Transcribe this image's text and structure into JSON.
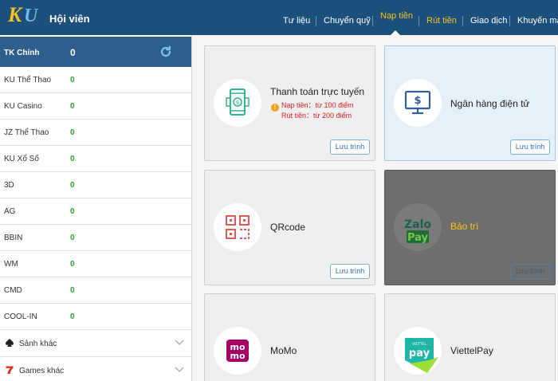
{
  "header": {
    "logo_text": "KU",
    "title": "Hội viên",
    "nav": [
      "Tư liệu",
      "Chuyển quỹ",
      "Nạp tiền",
      "Rút tiền",
      "Giao dịch",
      "Khuyến mãi"
    ],
    "active_nav": "Nạp tiền"
  },
  "sidebar": {
    "main_label": "TK Chính",
    "main_value": "0",
    "wallets": [
      {
        "name": "KU Thể Thao",
        "value": "0"
      },
      {
        "name": "KU Casino",
        "value": "0"
      },
      {
        "name": "JZ Thể Thao",
        "value": "0"
      },
      {
        "name": "KU Xổ Số",
        "value": "0"
      },
      {
        "name": "3D",
        "value": "0"
      },
      {
        "name": "AG",
        "value": "0"
      },
      {
        "name": "BBIN",
        "value": "0"
      },
      {
        "name": "WM",
        "value": "0"
      },
      {
        "name": "CMD",
        "value": "0"
      },
      {
        "name": "COOL-IN",
        "value": "0"
      }
    ],
    "more": [
      {
        "label": "Sảnh khác",
        "icon": "spade-icon"
      },
      {
        "label": "Games khác",
        "icon": "seven-icon"
      }
    ]
  },
  "cards": {
    "online": {
      "title": "Thanh toán trực tuyến",
      "note1": "Nạp tiền：từ 100 điểm",
      "note2": "Rút tiền：từ 200 điểm",
      "button": "Lưu trình"
    },
    "bank": {
      "title": "Ngân hàng điện tử",
      "button": "Lưu trình"
    },
    "qr": {
      "title": "QRcode",
      "button": "Lưu trình"
    },
    "zalo": {
      "title": "Bảo trì",
      "logo_top": "Zalo",
      "logo_bottom": "Pay",
      "button": "Lưu trình"
    },
    "momo": {
      "title": "MoMo",
      "logo_top": "mo",
      "logo_bottom": "mo"
    },
    "viettel": {
      "title": "ViettelPay",
      "logo_text": "pay",
      "logo_small": "VIETTEL"
    }
  },
  "colors": {
    "header_bg": "#1d4f7c",
    "active_nav": "#f5c518",
    "balance_green": "#2aa52a",
    "note_red": "#e02020",
    "button_blue": "#2f6fb0"
  }
}
